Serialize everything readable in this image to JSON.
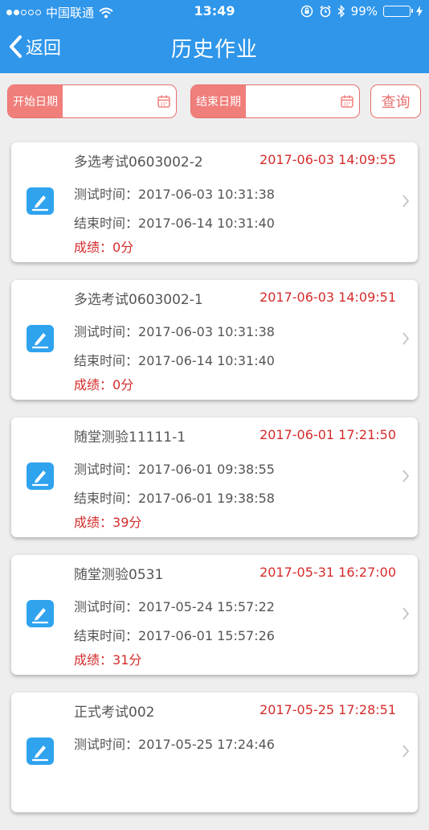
{
  "status_bar": {
    "carrier": "中国联通",
    "time": "13:49",
    "battery": "99%"
  },
  "nav": {
    "back_label": "返回",
    "title": "历史作业"
  },
  "filter": {
    "start_label": "开始日期",
    "start_value": "",
    "end_label": "结束日期",
    "end_value": "",
    "query_label": "查询"
  },
  "records": [
    {
      "title": "多选考试0603002-2",
      "time": "2017-06-03 14:09:55",
      "test_label": "测试时间：",
      "test_time": "2017-06-03 10:31:38",
      "end_label": "结束时间：",
      "end_time": "2017-06-14 10:31:40",
      "score_label": "成绩：",
      "score": "0分"
    },
    {
      "title": "多选考试0603002-1",
      "time": "2017-06-03 14:09:51",
      "test_label": "测试时间：",
      "test_time": "2017-06-03 10:31:38",
      "end_label": "结束时间：",
      "end_time": "2017-06-14 10:31:40",
      "score_label": "成绩：",
      "score": "0分"
    },
    {
      "title": "随堂测验11111-1",
      "time": "2017-06-01 17:21:50",
      "test_label": "测试时间：",
      "test_time": "2017-06-01 09:38:55",
      "end_label": "结束时间：",
      "end_time": "2017-06-01 19:38:58",
      "score_label": "成绩：",
      "score": "39分"
    },
    {
      "title": "随堂测验0531",
      "time": "2017-05-31 16:27:00",
      "test_label": "测试时间：",
      "test_time": "2017-05-24 15:57:22",
      "end_label": "结束时间：",
      "end_time": "2017-06-01 15:57:26",
      "score_label": "成绩：",
      "score": "31分"
    },
    {
      "title": "正式考试002",
      "time": "2017-05-25 17:28:51",
      "test_label": "测试时间：",
      "test_time": "2017-05-25 17:24:46",
      "end_label": "",
      "end_time": "",
      "score_label": "",
      "score": ""
    }
  ],
  "colors": {
    "nav_blue": "#2f96ea",
    "accent_red": "#d62b2b",
    "filter_pink": "#f07e7b",
    "icon_blue": "#2fa3ee"
  },
  "icons": {
    "back": "chevron-left-icon",
    "calendar": "calendar-icon",
    "record": "edit-pen-icon",
    "disclosure": "chevron-right-icon"
  }
}
